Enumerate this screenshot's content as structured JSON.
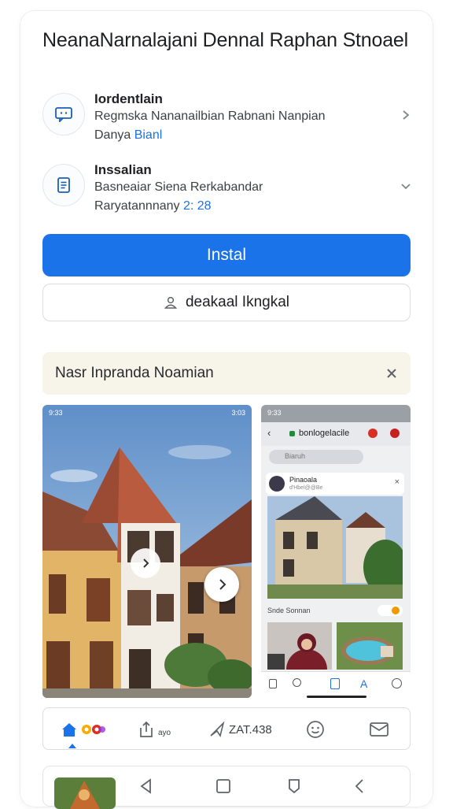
{
  "header": {
    "title": "NeanaNarnalajani Dennal Raphan Stnoael"
  },
  "permissions": [
    {
      "icon": "message-icon",
      "title": "Iordentlain",
      "line1": "Regmska Nananailbian Rabnani Nanpian",
      "line2_prefix": "Danya ",
      "line2_link": "Bianl"
    },
    {
      "icon": "document-icon",
      "title": "Inssalian",
      "line1": "Basneaiar Siena Rerkabandar",
      "line2_prefix": "Raryatannnany ",
      "line2_link": "2: 28"
    }
  ],
  "actions": {
    "install_label": "Instal",
    "secondary_label": "deakaal Ikngkal"
  },
  "banner": {
    "text": "Nasr Inpranda Noamian"
  },
  "screenshots": {
    "first": {
      "status_time": "9:33",
      "status_right": "3:03"
    },
    "second": {
      "status_time": "9:33",
      "app_bar_title": "bonlogelacile",
      "search_placeholder": "Biaruh",
      "notification_title": "Pinaoala",
      "notification_sub": "d'Hbel@@Be",
      "section_label": "Snde Sonnan"
    }
  },
  "bottom_tabs": {
    "share_label": "ayo",
    "stat_value": "ZAT.438"
  },
  "colors": {
    "accent": "#1a73e8",
    "banner_bg": "#f7f4ea"
  }
}
